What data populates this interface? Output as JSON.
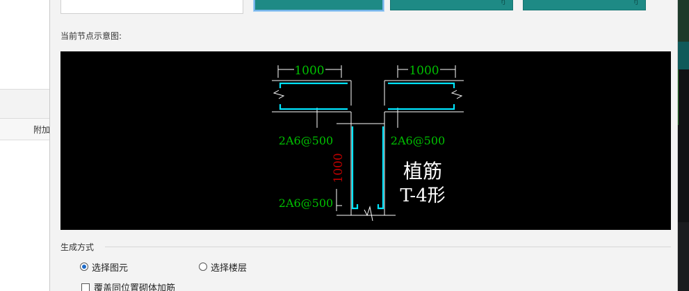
{
  "background": {
    "left_panel_label": "附加"
  },
  "top_buttons": [
    {
      "label": "",
      "selected": true
    },
    {
      "label": "",
      "selected": false
    },
    {
      "label": "",
      "selected": false
    }
  ],
  "preview": {
    "section_title": "当前节点示意图:",
    "dim_top_left": "1000",
    "dim_top_right": "1000",
    "dim_vertical": "1000",
    "rebar_label_left": "2A6@500",
    "rebar_label_right": "2A6@500",
    "rebar_label_bottom": "2A6@500",
    "caption_line1": "植筋",
    "caption_line2": "T-4形",
    "colors": {
      "dimension_text": "#00c000",
      "vertical_dimension": "#c00000",
      "rebar": "#00e5ff",
      "outline": "#ffffff"
    }
  },
  "generation": {
    "group_title": "生成方式",
    "options": [
      {
        "label": "选择图元",
        "checked": true
      },
      {
        "label": "选择楼层",
        "checked": false
      }
    ],
    "override_checkbox": {
      "label": "覆盖同位置砌体加筋",
      "checked": false
    }
  }
}
